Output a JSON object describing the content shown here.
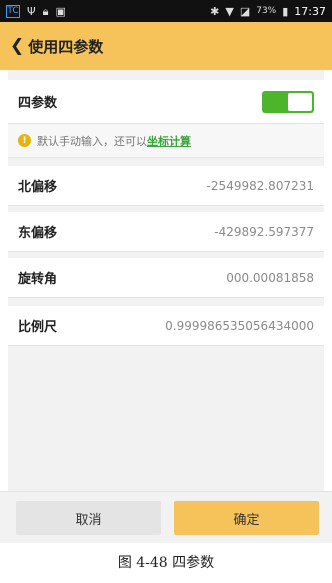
{
  "status_bar": {
    "app_icon": "TC",
    "left_icons": [
      "usb-icon",
      "lock-icon",
      "photo-icon"
    ],
    "battery": "73%",
    "time": "17:37"
  },
  "header": {
    "title": "使用四参数"
  },
  "toggle": {
    "label": "四参数",
    "state": "on",
    "accent": "#4bb52c"
  },
  "hint": {
    "text": "默认手动输入，还可以",
    "link": "坐标计算"
  },
  "fields": [
    {
      "label": "北偏移",
      "value": "-2549982.807231"
    },
    {
      "label": "东偏移",
      "value": "-429892.597377"
    },
    {
      "label": "旋转角",
      "value": "000.00081858"
    },
    {
      "label": "比例尺",
      "value": "0.999986535056434000"
    }
  ],
  "buttons": {
    "cancel": "取消",
    "ok": "确定"
  },
  "caption": "图 4-48 四参数",
  "colors": {
    "header_bg": "#f6c35a",
    "ok_bg": "#f6c35a",
    "toggle_on": "#4bb52c"
  }
}
